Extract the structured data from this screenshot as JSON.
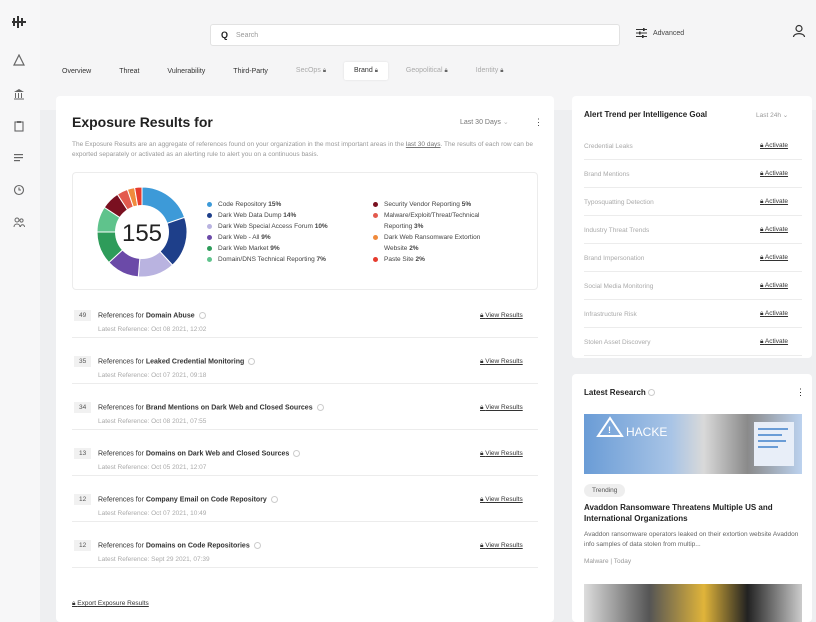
{
  "search": {
    "placeholder": "Search"
  },
  "header": {
    "advanced_label": "Advanced"
  },
  "rail_icons": [
    "logo-icon",
    "alert-icon",
    "bank-icon",
    "clipboard-icon",
    "list-icon",
    "clock-icon",
    "users-icon"
  ],
  "tabs": [
    {
      "label": "Overview",
      "locked": false,
      "muted": false
    },
    {
      "label": "Threat",
      "locked": false,
      "muted": false
    },
    {
      "label": "Vulnerability",
      "locked": false,
      "muted": false
    },
    {
      "label": "Third-Party",
      "locked": false,
      "muted": false
    },
    {
      "label": "SecOps",
      "locked": true,
      "muted": true
    },
    {
      "label": "Brand",
      "locked": true,
      "muted": false,
      "active": true
    },
    {
      "label": "Geopolitical",
      "locked": true,
      "muted": true
    },
    {
      "label": "Identity",
      "locked": true,
      "muted": true
    }
  ],
  "exposure": {
    "title": "Exposure Results for",
    "period": "Last 30 Days",
    "desc_a": "The Exposure Results are an aggregate of references found on your organization in the most important areas in the ",
    "desc_link": "last 30 days",
    "desc_b": ". The results of each row can be exported separately or activated as an alerting rule to alert you on a continuous basis.",
    "total": "155",
    "legend_left": [
      {
        "label": "Code Repository",
        "pct": "15%",
        "color": "#3d9ad8"
      },
      {
        "label": "Dark Web Data Dump",
        "pct": "14%",
        "color": "#1e3f8a"
      },
      {
        "label": "Dark Web Special Access Forum",
        "pct": "10%",
        "color": "#b9b3e0"
      },
      {
        "label": "Dark Web - All",
        "pct": "9%",
        "color": "#6b4aa8"
      },
      {
        "label": "Dark Web Market",
        "pct": "9%",
        "color": "#2e9c5a"
      },
      {
        "label": "Domain/DNS Technical Reporting",
        "pct": "7%",
        "color": "#5fc38c"
      }
    ],
    "legend_right": [
      {
        "label": "Security Vendor Reporting",
        "pct": "5%",
        "color": "#7a1020",
        "cont": ""
      },
      {
        "label": "Malware/Exploit/Threat/Technical",
        "pct": "3%",
        "color": "#e35a4e",
        "cont": "Reporting"
      },
      {
        "label": "Dark Web Ransomware Extortion",
        "pct": "2%",
        "color": "#f08a3c",
        "cont": "Website"
      },
      {
        "label": "Paste Site",
        "pct": "2%",
        "color": "#e63b2e",
        "cont": ""
      }
    ],
    "rows": [
      {
        "count": "49",
        "prefix": "References for ",
        "topic": "Domain Abuse",
        "latest": "Latest Reference: Oct 08 2021, 12:02",
        "action": "View Results"
      },
      {
        "count": "35",
        "prefix": "References for ",
        "topic": "Leaked Credential Monitoring",
        "latest": "Latest Reference: Oct 07 2021, 09:18",
        "action": "View Results"
      },
      {
        "count": "34",
        "prefix": "References for ",
        "topic": "Brand Mentions on Dark Web and Closed Sources",
        "latest": "Latest Reference: Oct 08 2021, 07:55",
        "action": "View Results"
      },
      {
        "count": "13",
        "prefix": "References for ",
        "topic": "Domains on Dark Web and Closed Sources",
        "latest": "Latest Reference: Oct 05 2021, 12:07",
        "action": "View Results"
      },
      {
        "count": "12",
        "prefix": "References for ",
        "topic": "Company Email on Code Repository",
        "latest": "Latest Reference: Oct 07 2021, 10:49",
        "action": "View Results"
      },
      {
        "count": "12",
        "prefix": "References for ",
        "topic": "Domains on Code Repositories",
        "latest": "Latest Reference: Sept 29 2021, 07:39",
        "action": "View Results"
      }
    ],
    "export_label": "Export Exposure Results"
  },
  "alert_trend": {
    "title": "Alert Trend per Intelligence Goal",
    "period": "Last 24h",
    "items": [
      {
        "label": "Credential Leaks",
        "action": "Activate"
      },
      {
        "label": "Brand Mentions",
        "action": "Activate"
      },
      {
        "label": "Typosquatting Detection",
        "action": "Activate"
      },
      {
        "label": "Industry Threat Trends",
        "action": "Activate"
      },
      {
        "label": "Brand Impersonation",
        "action": "Activate"
      },
      {
        "label": "Social Media Monitoring",
        "action": "Activate"
      },
      {
        "label": "Infrastructure Risk",
        "action": "Activate"
      },
      {
        "label": "Stolen Asset Discovery",
        "action": "Activate"
      }
    ]
  },
  "research": {
    "title": "Latest Research",
    "image_text": "HACKE",
    "tag": "Trending",
    "headline": "Avaddon Ransomware Threatens Multiple US and International Organizations",
    "summary": "Avaddon ransomware operators leaked on their extortion website Avaddon info samples of data stolen from multip...",
    "meta": "Malware | Today"
  }
}
